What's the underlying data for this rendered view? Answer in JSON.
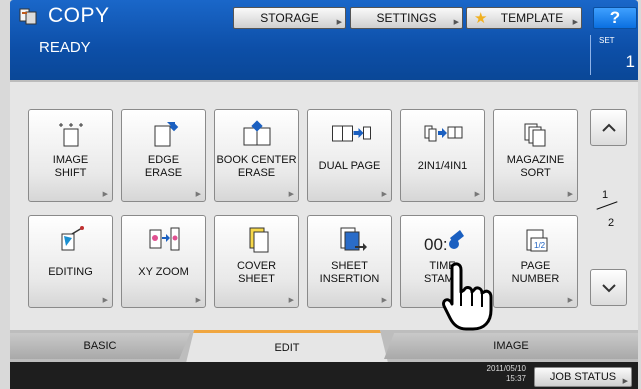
{
  "header": {
    "title": "COPY",
    "status": "READY",
    "buttons": {
      "storage": "STORAGE",
      "settings": "SETTINGS",
      "template": "TEMPLATE",
      "help": "?"
    },
    "set_label": "SET",
    "set_value": "1",
    "colors": {
      "header_bg": "#0d4fa8",
      "help_bg": "#0a6fe0"
    }
  },
  "functions": [
    {
      "label": "IMAGE\nSHIFT",
      "icon": "image-shift-icon"
    },
    {
      "label": "EDGE\nERASE",
      "icon": "edge-erase-icon"
    },
    {
      "label": "BOOK CENTER\nERASE",
      "icon": "book-center-erase-icon"
    },
    {
      "label": "DUAL PAGE",
      "icon": "dual-page-icon"
    },
    {
      "label": "2IN1/4IN1",
      "icon": "2in1-4in1-icon"
    },
    {
      "label": "MAGAZINE\nSORT",
      "icon": "magazine-sort-icon"
    },
    {
      "label": "EDITING",
      "icon": "editing-icon"
    },
    {
      "label": "XY ZOOM",
      "icon": "xy-zoom-icon"
    },
    {
      "label": "COVER\nSHEET",
      "icon": "cover-sheet-icon"
    },
    {
      "label": "SHEET\nINSERTION",
      "icon": "sheet-insertion-icon"
    },
    {
      "label": "TIME\nSTAMP",
      "icon": "time-stamp-icon"
    },
    {
      "label": "PAGE\nNUMBER",
      "icon": "page-number-icon"
    }
  ],
  "pager": {
    "current": "1",
    "total": "2"
  },
  "tabs": {
    "basic": "BASIC",
    "edit": "EDIT",
    "image": "IMAGE",
    "active": "EDIT",
    "active_color": "#f0a640"
  },
  "footer": {
    "date": "2011/05/10",
    "time": "15:37",
    "job_status": "JOB STATUS"
  }
}
